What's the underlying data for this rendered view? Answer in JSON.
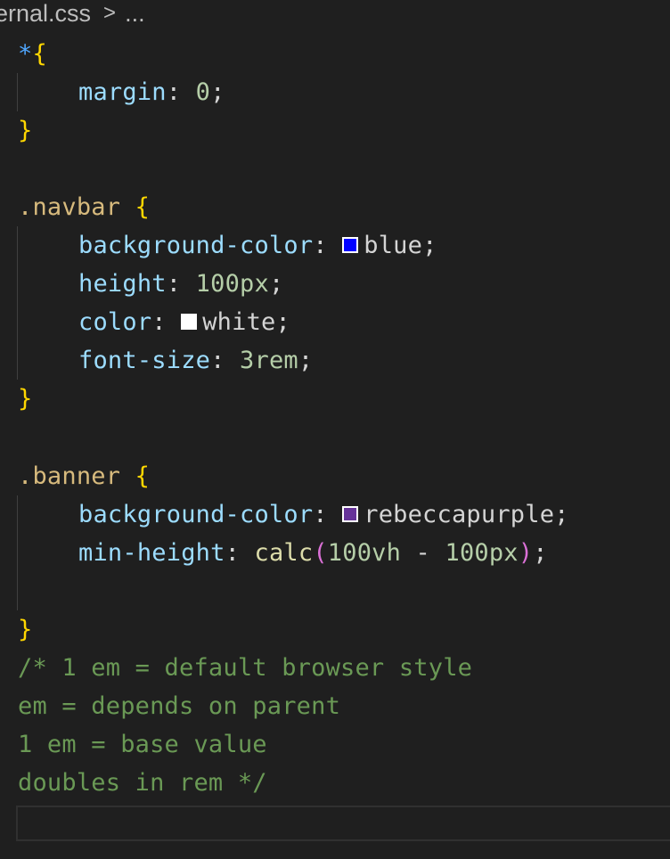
{
  "breadcrumb": {
    "file": "ernal.css",
    "separator": ">",
    "more": "..."
  },
  "colors": {
    "background": "#1f1f1f",
    "property": "#9cdcfe",
    "selector": "#d7ba7d",
    "brace": "#ffd700",
    "number": "#b5cea8",
    "comment": "#6a9955",
    "swatch_blue": "#0000ff",
    "swatch_white": "#ffffff",
    "swatch_rebeccapurple": "#663399"
  },
  "code": {
    "l1": {
      "selector": "*",
      "open": "{"
    },
    "l2": {
      "prop": "margin",
      "colon": ":",
      "value": "0",
      "semi": ";"
    },
    "l3": {
      "close": "}"
    },
    "l5": {
      "selector": ".navbar",
      "open": "{"
    },
    "l6": {
      "prop": "background-color",
      "colon": ":",
      "value": "blue",
      "semi": ";"
    },
    "l7": {
      "prop": "height",
      "colon": ":",
      "value": "100px",
      "semi": ";"
    },
    "l8": {
      "prop": "color",
      "colon": ":",
      "value": "white",
      "semi": ";"
    },
    "l9": {
      "prop": "font-size",
      "colon": ":",
      "value": "3rem",
      "semi": ";"
    },
    "l10": {
      "close": "}"
    },
    "l12": {
      "selector": ".banner",
      "open": "{"
    },
    "l13": {
      "prop": "background-color",
      "colon": ":",
      "value": "rebeccapurple",
      "semi": ";"
    },
    "l14": {
      "prop": "min-height",
      "colon": ":",
      "func": "calc",
      "paren_open": "(",
      "arg1": "100vh",
      "op": "-",
      "arg2": "100px",
      "paren_close": ")",
      "semi": ";"
    },
    "l16": {
      "close": "}"
    },
    "l17": {
      "comment": "/* 1 em = default browser style"
    },
    "l18": {
      "comment": "em = depends on parent"
    },
    "l19": {
      "comment": "1 em = base value"
    },
    "l20": {
      "comment": "doubles in rem */"
    }
  }
}
